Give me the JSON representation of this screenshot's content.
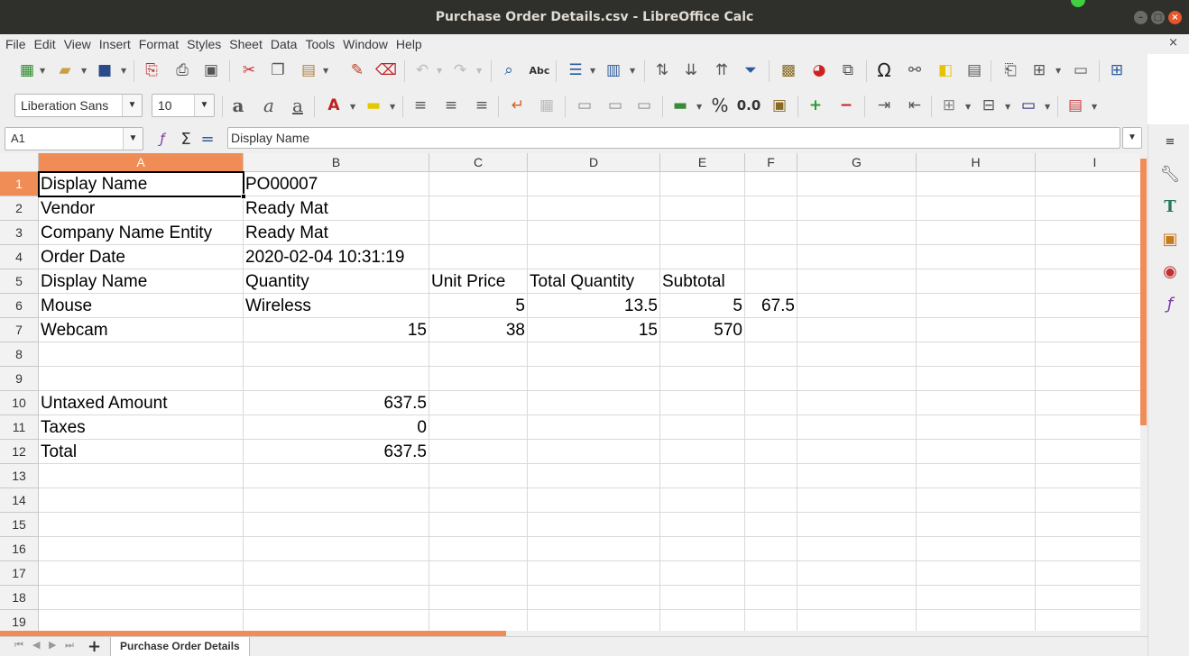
{
  "window": {
    "title": "Purchase Order Details.csv - LibreOffice Calc"
  },
  "menu": [
    "File",
    "Edit",
    "View",
    "Insert",
    "Format",
    "Styles",
    "Sheet",
    "Data",
    "Tools",
    "Window",
    "Help"
  ],
  "doc_close": "×",
  "font_name": "Liberation Sans",
  "font_size": "10",
  "name_box": "A1",
  "formula_content": "Display Name",
  "toolbar_labels": {
    "percent": "%",
    "decimal": "0.0",
    "omega": "Ω",
    "abc": "Abc"
  },
  "columns": [
    "A",
    "B",
    "C",
    "D",
    "E",
    "F",
    "G",
    "H",
    "I"
  ],
  "rows": [
    "1",
    "2",
    "3",
    "4",
    "5",
    "6",
    "7",
    "8",
    "9",
    "10",
    "11",
    "12",
    "13",
    "14",
    "15",
    "16",
    "17",
    "18",
    "19"
  ],
  "cells": {
    "r1": {
      "a": "Display Name",
      "b": "PO00007"
    },
    "r2": {
      "a": "Vendor",
      "b": "Ready Mat"
    },
    "r3": {
      "a": "Company Name Entity",
      "b": "Ready Mat"
    },
    "r4": {
      "a": "Order Date",
      "b": "2020-02-04 10:31:19"
    },
    "r5": {
      "a": "Display Name",
      "b": "Quantity",
      "c": "Unit Price",
      "d": "Total Quantity",
      "e": "Subtotal"
    },
    "r6": {
      "a": "Mouse",
      "b": " Wireless",
      "c": "5",
      "d": "13.5",
      "e": "5",
      "f": "67.5"
    },
    "r7": {
      "a": "Webcam",
      "b": "15",
      "c": "38",
      "d": "15",
      "e": "570"
    },
    "r10": {
      "a": "Untaxed Amount",
      "b": "637.5"
    },
    "r11": {
      "a": "Taxes",
      "b": "0"
    },
    "r12": {
      "a": "Total",
      "b": "637.5"
    }
  },
  "sheet_tab": "Purchase Order Details",
  "colors": {
    "accent": "#f08c55",
    "titlebar": "#2f2f2b",
    "chrome": "#efefef"
  }
}
